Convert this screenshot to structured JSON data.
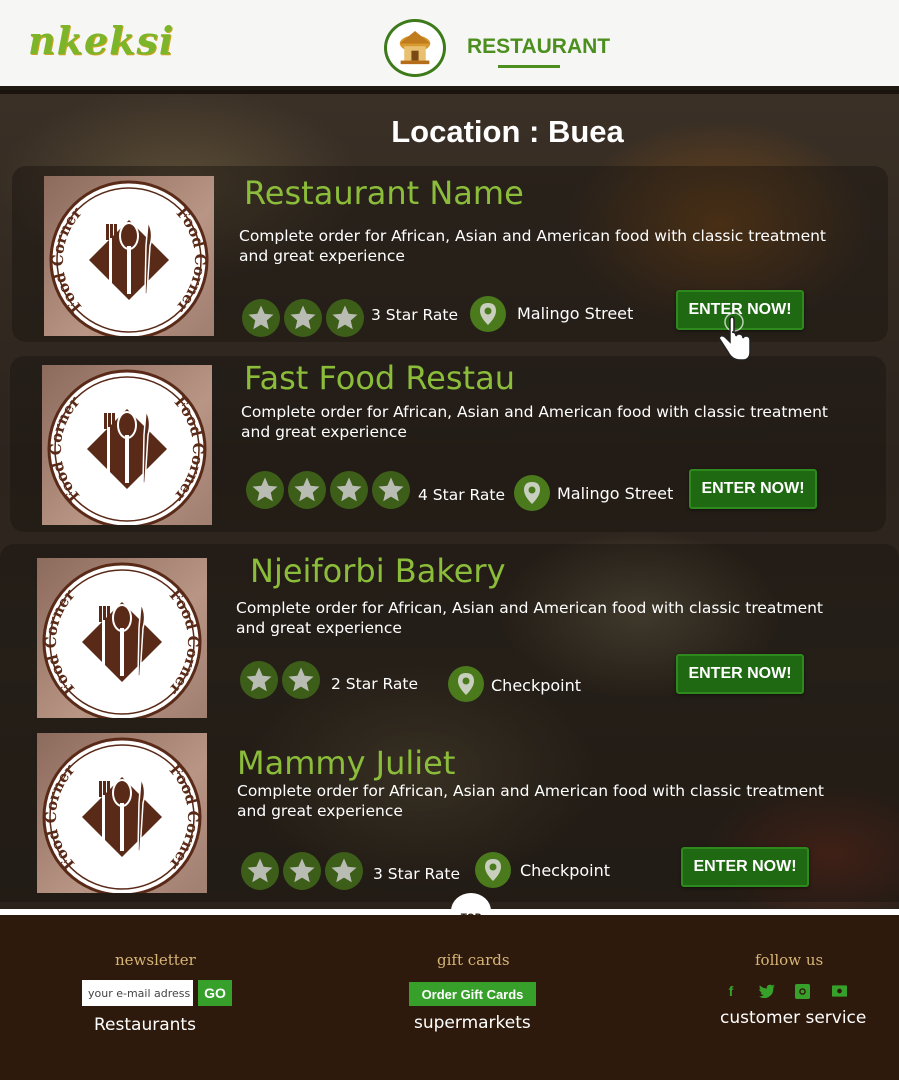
{
  "header": {
    "logo": "nkeksi",
    "section_title": "RESTAURANT"
  },
  "location_label": "Location : Buea",
  "restaurants": [
    {
      "name": "Restaurant Name",
      "description": "Complete order for African, Asian and American food with classic treatment\n and great experience",
      "stars": 3,
      "rating": "3 Star Rate",
      "street": "Malingo Street",
      "button": "ENTER NOW!"
    },
    {
      "name": "Fast Food Restau",
      "description": "Complete order for African, Asian and American food with classic treatment\n and great experience",
      "stars": 4,
      "rating": "4 Star Rate",
      "street": "Malingo Street",
      "button": "ENTER NOW!"
    },
    {
      "name": "Njeiforbi Bakery",
      "description": "Complete order for African, Asian and American food with classic treatment\n and great experience",
      "stars": 2,
      "rating": "2 Star Rate",
      "street": "Checkpoint",
      "button": "ENTER NOW!"
    },
    {
      "name": "Mammy Juliet",
      "description": "Complete order for African, Asian and American food with classic treatment\n and great experience",
      "stars": 3,
      "rating": "3 Star Rate",
      "street": "Checkpoint",
      "button": "ENTER NOW!"
    }
  ],
  "logo_badge": {
    "text_top": "Food Corner",
    "text_bottom": "Food Corner"
  },
  "top_button": "TOP",
  "footer": {
    "newsletter": {
      "heading": "newsletter",
      "placeholder": "your e-mail adress",
      "go_label": "GO",
      "link": "Restaurants"
    },
    "gift_cards": {
      "heading": "gift cards",
      "button": "Order Gift Cards",
      "link": "supermarkets"
    },
    "follow": {
      "heading": "follow us",
      "icons": [
        "facebook-icon",
        "twitter-icon",
        "instagram-icon",
        "youtube-icon"
      ],
      "link": "customer service"
    }
  },
  "colors": {
    "accent": "#8bbd3a",
    "button": "#1f6912",
    "footer": "#2e1a0c"
  }
}
